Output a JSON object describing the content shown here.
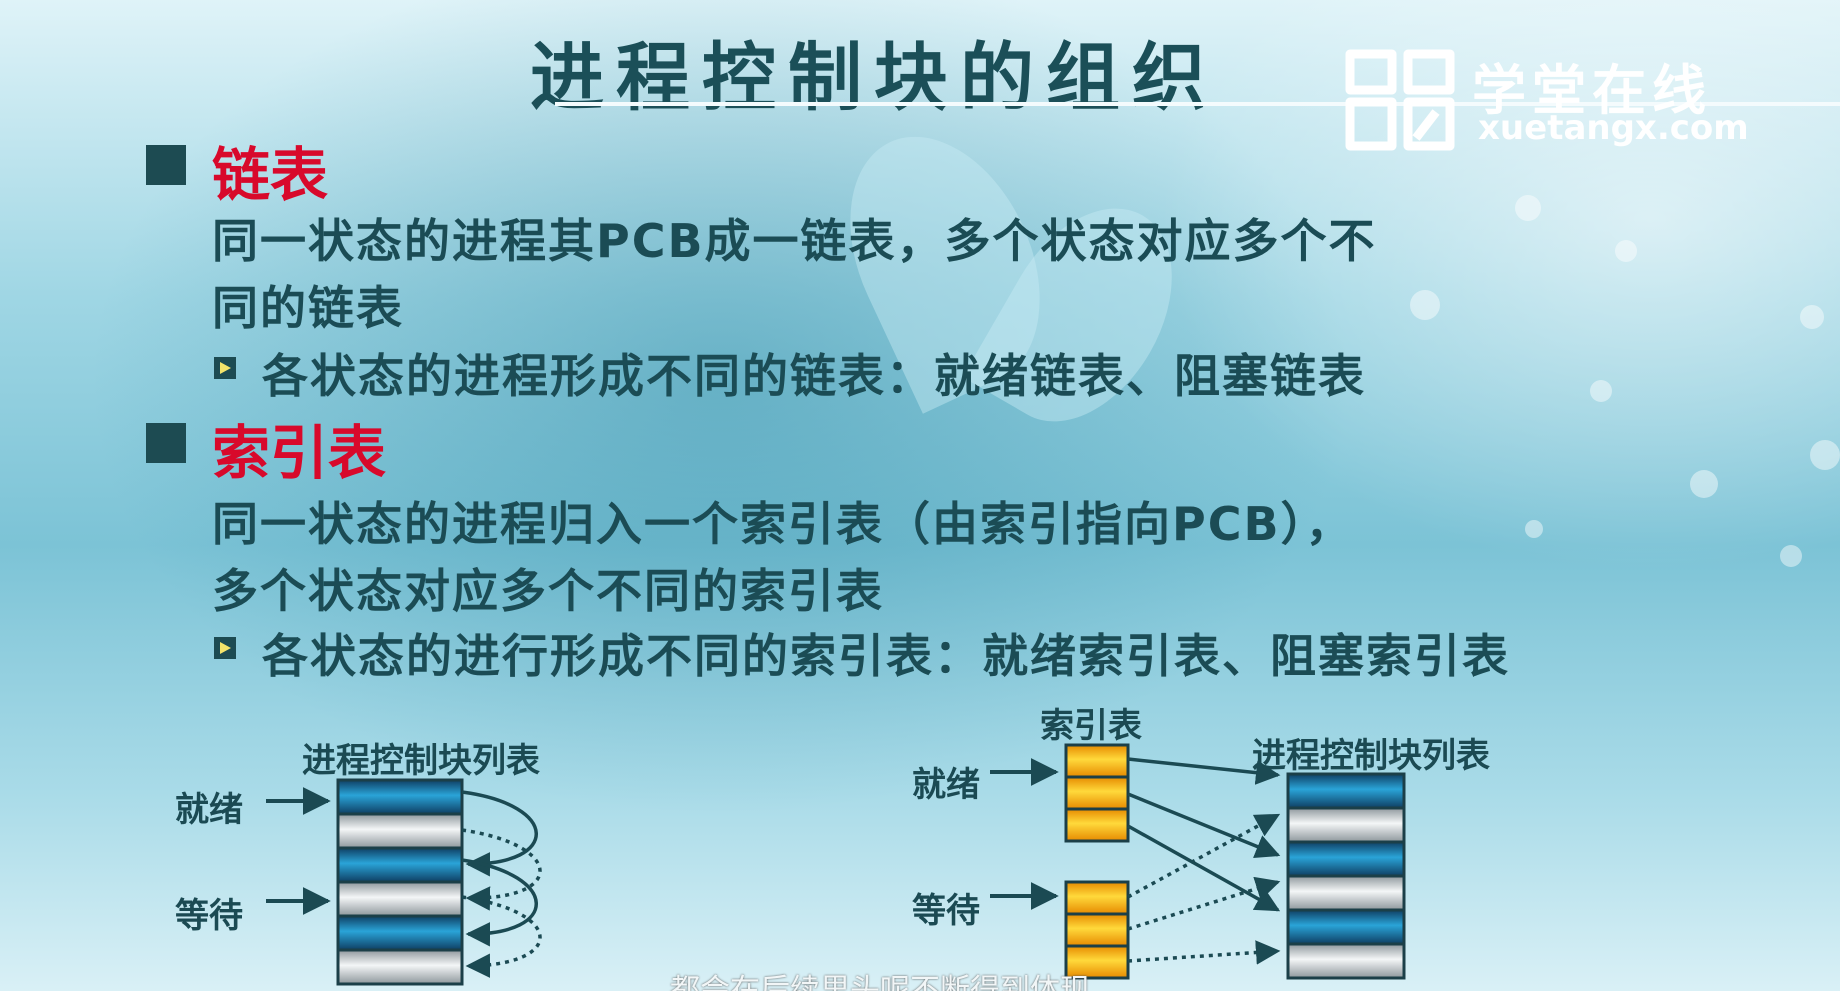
{
  "title": "进程控制块的组织",
  "logo": {
    "name": "学堂在线",
    "url": "xuetangx.com"
  },
  "sections": [
    {
      "heading": "链表",
      "lines": [
        "同一状态的进程其PCB成一链表，多个状态对应多个不",
        "同的链表"
      ],
      "sub": "各状态的进程形成不同的链表：就绪链表、阻塞链表"
    },
    {
      "heading": "索引表",
      "lines": [
        "同一状态的进程归入一个索引表（由索引指向PCB），",
        "多个状态对应多个不同的索引表"
      ],
      "sub": "各状态的进行形成不同的索引表：就绪索引表、阻塞索引表"
    }
  ],
  "diagram_left": {
    "table_title": "进程控制块列表",
    "ready_label": "就绪",
    "wait_label": "等待"
  },
  "diagram_right": {
    "index_title": "索引表",
    "table_title": "进程控制块列表",
    "ready_label": "就绪",
    "wait_label": "等待"
  },
  "subtitle": "都会在后续里头呢不断得到体现",
  "colors": {
    "title": "#1b4f58",
    "heading_red": "#d8092b",
    "body_text": "#1b4c55",
    "pcb_blue": "#1c86c0",
    "pcb_gray": "#c8cdd0",
    "index_yellow": "#f2b318"
  }
}
